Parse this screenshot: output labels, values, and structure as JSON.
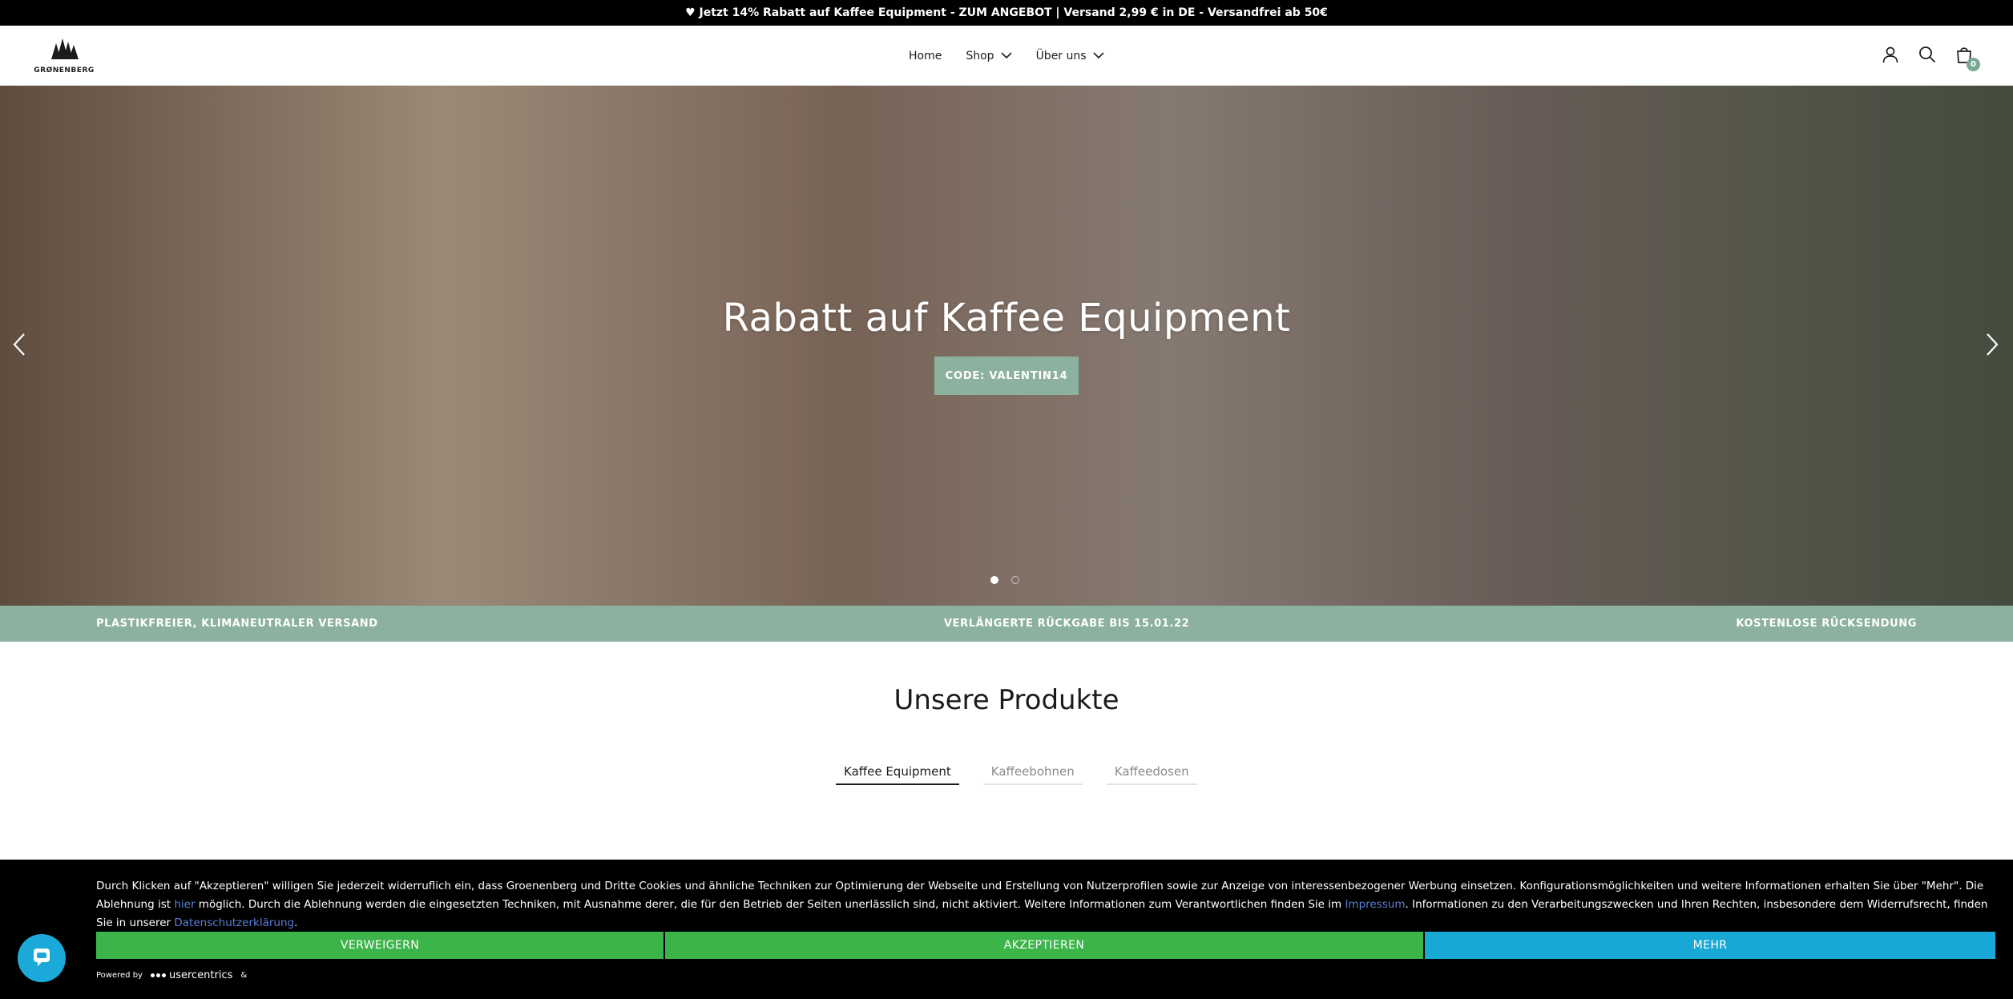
{
  "announcement": "♥ Jetzt 14% Rabatt auf Kaffee Equipment - ZUM ANGEBOT | Versand 2,99 € in DE - Versandfrei ab 50€",
  "header": {
    "logo_text": "GRØNENBERG",
    "nav": [
      "Home",
      "Shop",
      "Über uns"
    ],
    "cart_count": "0"
  },
  "hero": {
    "heading": "Rabatt auf Kaffee Equipment",
    "button_label": "CODE: VALENTIN14",
    "slide_count": 2,
    "active_slide": 1
  },
  "usp": [
    "PLASTIKFREIER, KLIMANEUTRALER VERSAND",
    "VERLÄNGERTE RÜCKGABE BIS 15.01.22",
    "KOSTENLOSE RÜCKSENDUNG"
  ],
  "products": {
    "title": "Unsere Produkte",
    "tabs": [
      "Kaffee Equipment",
      "Kaffeebohnen",
      "Kaffeedosen"
    ],
    "active_tab": 0
  },
  "cookie": {
    "text_part1": "Durch Klicken auf \"Akzeptieren\" willigen Sie jederzeit widerruflich ein, dass Groenenberg und Dritte Cookies und ähnliche Techniken zur Optimierung der Webseite und Erstellung von Nutzerprofilen sowie zur Anzeige von interessenbezogener Werbung einsetzen. Konfigurationsmöglichkeiten und weitere Informationen erhalten Sie über \"Mehr\". Die Ablehnung ist ",
    "link_hier": "hier",
    "text_part2": " möglich. Durch die Ablehnung werden die eingesetzten Techniken, mit Ausnahme derer, die für den Betrieb der Seiten unerlässlich sind, nicht aktiviert. Weitere Informationen zum Verantwortlichen finden Sie im ",
    "link_impressum": "Impressum",
    "text_part3": ". Informationen zu den Verarbeitungszwecken und Ihren Rechten, insbesondere dem Widerrufsrecht, finden Sie in unserer ",
    "link_datenschutz": "Datenschutzerklärung",
    "text_part4": ".",
    "reject_label": "VERWEIGERN",
    "accept_label": "AKZEPTIEREN",
    "more_label": "MEHR",
    "powered_by": "Powered by",
    "brand": "usercentrics",
    "ampersand": "&"
  },
  "colors": {
    "accent_green": "#8cb19f",
    "cookie_accept": "#3bb44a",
    "cookie_more": "#17a8d6",
    "link_blue": "#5b7fd6"
  },
  "icons": [
    "logo-trees-icon",
    "chevron-down-icon",
    "account-icon",
    "search-icon",
    "cart-icon",
    "arrow-left-icon",
    "arrow-right-icon",
    "chat-icon"
  ]
}
